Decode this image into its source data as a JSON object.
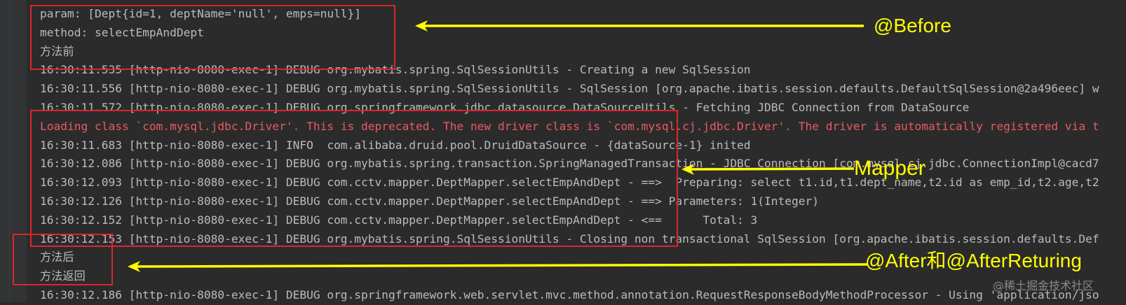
{
  "console": {
    "lines": [
      {
        "text": "param: [Dept{id=1, deptName='null', emps=null}]",
        "type": "info"
      },
      {
        "text": "method: selectEmpAndDept",
        "type": "info"
      },
      {
        "text": "方法前",
        "type": "info"
      },
      {
        "text": "16:30:11.535 [http-nio-8080-exec-1] DEBUG org.mybatis.spring.SqlSessionUtils - Creating a new SqlSession",
        "type": "info"
      },
      {
        "text": "16:30:11.556 [http-nio-8080-exec-1] DEBUG org.mybatis.spring.SqlSessionUtils - SqlSession [org.apache.ibatis.session.defaults.DefaultSqlSession@2a496eec] w",
        "type": "info"
      },
      {
        "text": "16:30:11.572 [http-nio-8080-exec-1] DEBUG org.springframework.jdbc.datasource.DataSourceUtils - Fetching JDBC Connection from DataSource",
        "type": "info"
      },
      {
        "text": "Loading class `com.mysql.jdbc.Driver'. This is deprecated. The new driver class is `com.mysql.cj.jdbc.Driver'. The driver is automatically registered via t",
        "type": "error"
      },
      {
        "text": "16:30:11.683 [http-nio-8080-exec-1] INFO  com.alibaba.druid.pool.DruidDataSource - {dataSource-1} inited",
        "type": "info"
      },
      {
        "text": "16:30:12.086 [http-nio-8080-exec-1] DEBUG org.mybatis.spring.transaction.SpringManagedTransaction - JDBC Connection [com.mysql.cj.jdbc.ConnectionImpl@cacd7",
        "type": "info"
      },
      {
        "text": "16:30:12.093 [http-nio-8080-exec-1] DEBUG com.cctv.mapper.DeptMapper.selectEmpAndDept - ==>  Preparing: select t1.id,t1.dept_name,t2.id as emp_id,t2.age,t2",
        "type": "info"
      },
      {
        "text": "16:30:12.126 [http-nio-8080-exec-1] DEBUG com.cctv.mapper.DeptMapper.selectEmpAndDept - ==> Parameters: 1(Integer)",
        "type": "info"
      },
      {
        "text": "16:30:12.152 [http-nio-8080-exec-1] DEBUG com.cctv.mapper.DeptMapper.selectEmpAndDept - <==      Total: 3",
        "type": "info"
      },
      {
        "text": "16:30:12.153 [http-nio-8080-exec-1] DEBUG org.mybatis.spring.SqlSessionUtils - Closing non transactional SqlSession [org.apache.ibatis.session.defaults.Def",
        "type": "info"
      },
      {
        "text": "方法后",
        "type": "info"
      },
      {
        "text": "方法返回",
        "type": "info"
      },
      {
        "text": "16:30:12.186 [http-nio-8080-exec-1] DEBUG org.springframework.web.servlet.mvc.method.annotation.RequestResponseBodyMethodProcessor - Using 'application/jso",
        "type": "info"
      }
    ]
  },
  "annotations": {
    "before": "@Before",
    "mapper": "Mapper",
    "after": "@After和@AfterReturing"
  },
  "watermark": "@稀土掘金技术社区",
  "colors": {
    "background": "#2b2b2b",
    "text": "#bbbbbb",
    "error_text": "#e85a5f",
    "highlight_box": "#d9262f",
    "annotation": "#ffff00"
  }
}
